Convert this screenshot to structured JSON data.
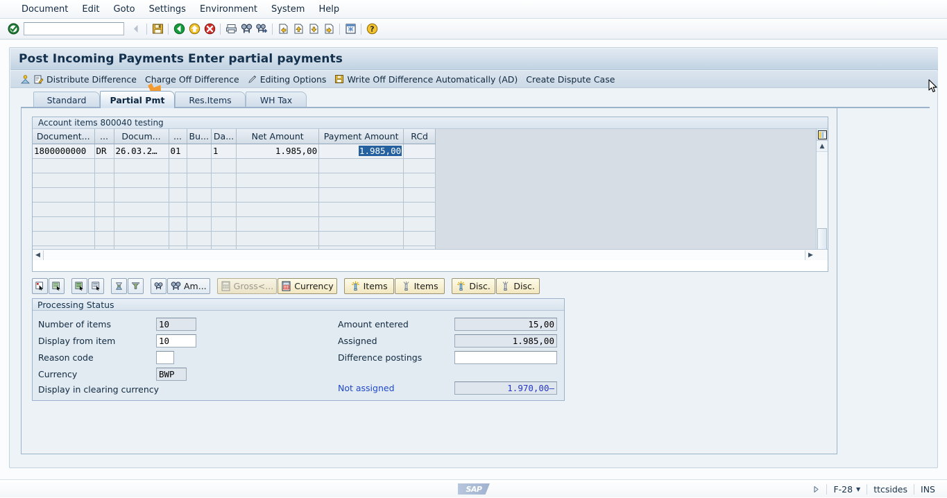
{
  "menu": {
    "items": [
      "Document",
      "Edit",
      "Goto",
      "Settings",
      "Environment",
      "System",
      "Help"
    ]
  },
  "toolbar": {
    "command_value": "",
    "command_placeholder": "",
    "icons": [
      "enter-check-icon",
      "back-arrow-icon",
      "save-icon",
      "back-green-icon",
      "exit-yellow-icon",
      "cancel-red-icon",
      "print-icon",
      "find-icon",
      "find-next-icon",
      "first-page-icon",
      "previous-page-icon",
      "next-page-icon",
      "last-page-icon",
      "new-window-icon",
      "help-icon"
    ]
  },
  "window": {
    "title": "Post Incoming Payments Enter partial payments"
  },
  "actionbar": {
    "buttons": [
      {
        "label": "Distribute Difference",
        "icon": "distribute-icon"
      },
      {
        "label": "Charge Off Difference",
        "icon": ""
      },
      {
        "label": "Editing Options",
        "icon": "pencil-icon"
      },
      {
        "label": "Write Off Difference Automatically (AD)",
        "icon": "writeoff-icon"
      },
      {
        "label": "Create Dispute Case",
        "icon": ""
      }
    ]
  },
  "tabs": [
    {
      "label": "Standard",
      "active": false
    },
    {
      "label": "Partial Pmt",
      "active": true
    },
    {
      "label": "Res.Items",
      "active": false
    },
    {
      "label": "WH Tax",
      "active": false
    }
  ],
  "table": {
    "caption": "Account items 800040 testing",
    "columns": [
      "Document...",
      "...",
      "Docum...",
      "...",
      "Bu...",
      "Da...",
      "Net Amount",
      "Payment Amount",
      "RCd"
    ],
    "rows": [
      {
        "document": "1800000000",
        "type": "DR",
        "doc_date": "26.03.2…",
        "col4": "01",
        "business": "",
        "days": "1",
        "net_amount": "1.985,00",
        "payment_amount": "1.985,00",
        "rcd": ""
      }
    ],
    "empty_row_count": 7,
    "selected_cell": "payment_amount"
  },
  "buttonrow": [
    {
      "name": "select-all-button",
      "label": "",
      "icon": "select-all-icon",
      "style": "plain",
      "disabled": false
    },
    {
      "name": "deselect-all-button",
      "label": "",
      "icon": "deselect-all-icon",
      "style": "plain",
      "disabled": false
    },
    {
      "name": "activate-items-button",
      "label": "",
      "icon": "activate-items-icon",
      "style": "plain",
      "disabled": false
    },
    {
      "name": "deactivate-items-button",
      "label": "",
      "icon": "deactivate-items-icon",
      "style": "plain",
      "disabled": false
    },
    {
      "name": "sort-ascending-button",
      "label": "",
      "icon": "sort-asc-icon",
      "style": "plain",
      "disabled": false
    },
    {
      "name": "filter-button",
      "label": "",
      "icon": "filter-icon",
      "style": "plain",
      "disabled": false
    },
    {
      "name": "search-button",
      "label": "",
      "icon": "binoculars-icon",
      "style": "plain",
      "disabled": false
    },
    {
      "name": "search-amount-button",
      "label": "Am...",
      "icon": "binoculars-icon",
      "style": "plain",
      "disabled": false
    },
    {
      "name": "gross-button",
      "label": "Gross<...",
      "icon": "calculator-icon",
      "style": "yellow",
      "disabled": true
    },
    {
      "name": "currency-button",
      "label": "Currency",
      "icon": "calculator-red-icon",
      "style": "yellow",
      "disabled": false
    },
    {
      "name": "items-on-button",
      "label": "Items",
      "icon": "lamp-on-icon",
      "style": "yellow",
      "disabled": false
    },
    {
      "name": "items-off-button",
      "label": "Items",
      "icon": "lamp-off-icon",
      "style": "yellow",
      "disabled": false
    },
    {
      "name": "disc-on-button",
      "label": "Disc.",
      "icon": "lamp-on-icon",
      "style": "yellow",
      "disabled": false
    },
    {
      "name": "disc-off-button",
      "label": "Disc.",
      "icon": "lamp-off-icon",
      "style": "yellow",
      "disabled": false
    }
  ],
  "processing_status": {
    "title": "Processing Status",
    "left_fields": [
      {
        "label": "Number of items",
        "value": "10",
        "editable": false
      },
      {
        "label": "Display from item",
        "value": "10",
        "editable": true
      },
      {
        "label": "Reason code",
        "value": "",
        "editable": true
      },
      {
        "label": "Currency",
        "value": "BWP",
        "editable": false
      }
    ],
    "clearing_label": "Display in clearing currency",
    "right_fields": [
      {
        "label": "Amount entered",
        "value": "15,00",
        "editable": false
      },
      {
        "label": "Assigned",
        "value": "1.985,00",
        "editable": false
      },
      {
        "label": "Difference postings",
        "value": "",
        "editable": true
      }
    ],
    "not_assigned_label": "Not assigned",
    "not_assigned_value": "1.970,00–"
  },
  "statusbar": {
    "logo": "SAP",
    "transaction": "F-28",
    "system": "ttcsides",
    "mode": "INS"
  },
  "colors": {
    "accent_blue": "#2437c8",
    "link_blue": "#1f49c6",
    "selection": "#24619e",
    "focus_red": "#dd3322",
    "pointer_orange": "#f59a2e"
  }
}
